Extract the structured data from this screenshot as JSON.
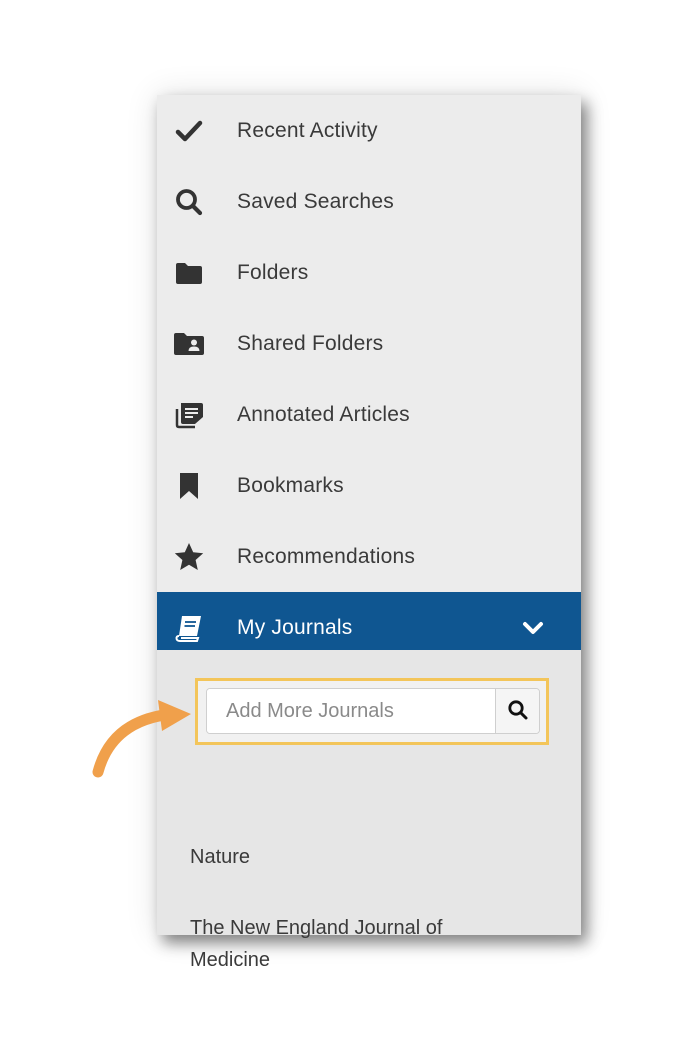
{
  "nav": {
    "items": [
      {
        "label": "Recent Activity",
        "icon": "check-icon"
      },
      {
        "label": "Saved Searches",
        "icon": "search-icon"
      },
      {
        "label": "Folders",
        "icon": "folder-icon"
      },
      {
        "label": "Shared Folders",
        "icon": "shared-folder-icon"
      },
      {
        "label": "Annotated Articles",
        "icon": "annotated-articles-icon"
      },
      {
        "label": "Bookmarks",
        "icon": "bookmark-icon"
      },
      {
        "label": "Recommendations",
        "icon": "star-icon"
      },
      {
        "label": "My Journals",
        "icon": "book-icon",
        "active": true,
        "expanded": true
      }
    ]
  },
  "journals": {
    "search": {
      "placeholder": "Add More Journals",
      "value": ""
    },
    "list": [
      "Nature",
      "The New England Journal of Medicine"
    ]
  },
  "colors": {
    "active_bg": "#0f5691",
    "panel_bg": "#ececec",
    "highlight": "#f3c55a",
    "arrow": "#f0a04b"
  }
}
